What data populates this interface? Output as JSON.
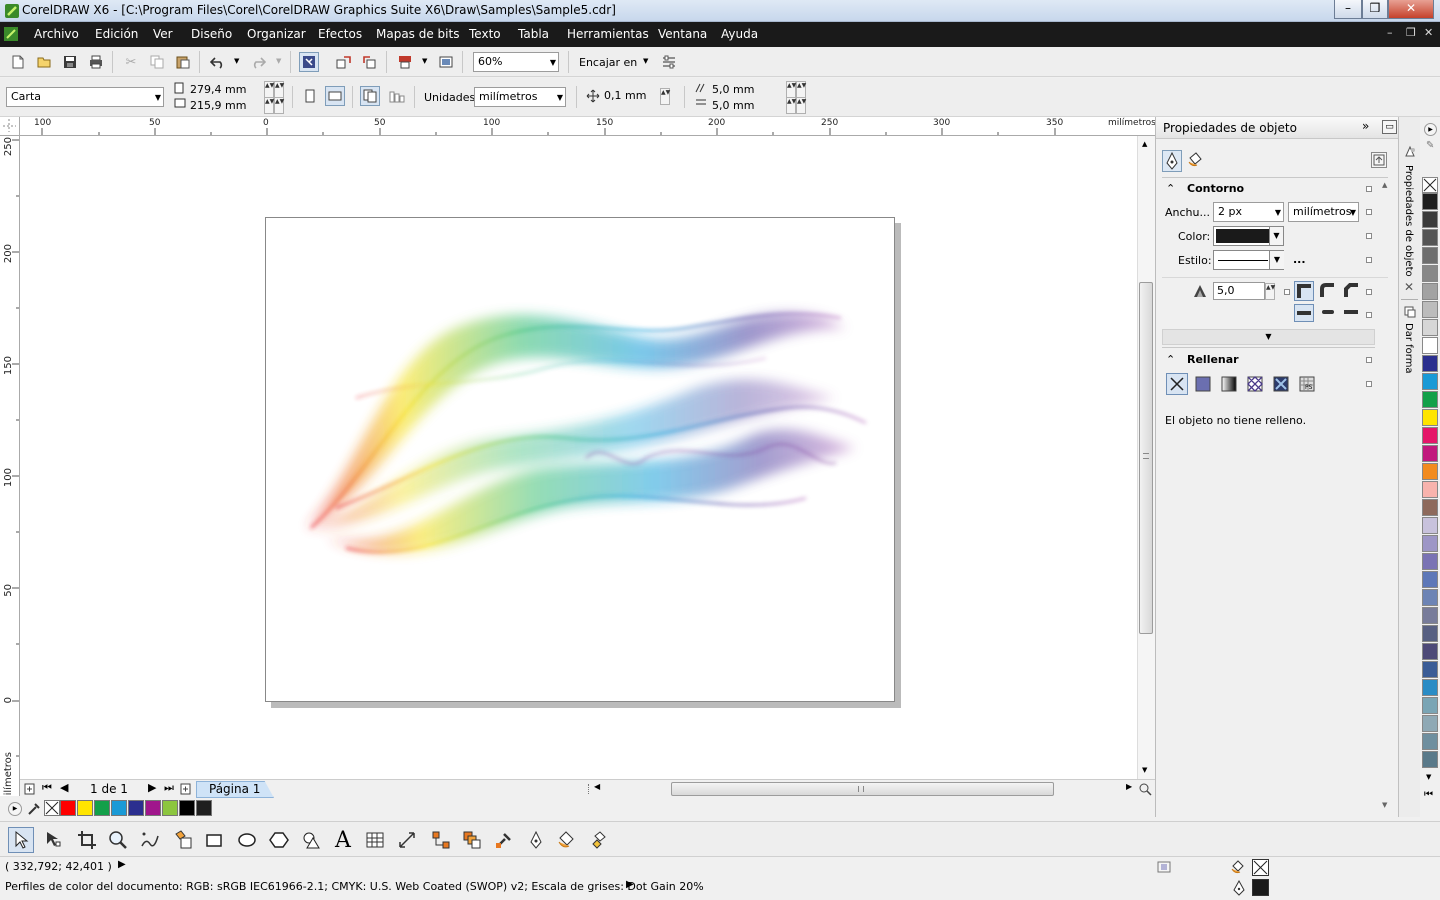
{
  "window": {
    "title": "CorelDRAW X6 - [C:\\Program Files\\Corel\\CorelDRAW Graphics Suite X6\\Draw\\Samples\\Sample5.cdr]",
    "minimize": "–",
    "restore": "❒",
    "close": "✕"
  },
  "menu": {
    "items": [
      "Archivo",
      "Edición",
      "Ver",
      "Diseño",
      "Organizar",
      "Efectos",
      "Mapas de bits",
      "Texto",
      "Tabla",
      "Herramientas",
      "Ventana",
      "Ayuda"
    ],
    "doc_min": "–",
    "doc_restore": "❒",
    "doc_close": "✕"
  },
  "standard_toolbar": {
    "zoom_value": "60%",
    "snap_label": "Encajar en"
  },
  "property_bar": {
    "page_size": "Carta",
    "width": "279,4 mm",
    "height": "215,9 mm",
    "units_label": "Unidades:",
    "units_value": "milímetros",
    "nudge": "0,1 mm",
    "dup_x": "5,0 mm",
    "dup_y": "5,0 mm"
  },
  "rulers": {
    "h_labels": [
      "100",
      "50",
      "0",
      "50",
      "100",
      "150",
      "200",
      "250",
      "300",
      "350"
    ],
    "h_unit": "milímetros",
    "v_labels": [
      "250",
      "200",
      "150",
      "100",
      "50",
      "0"
    ],
    "v_unit": "milímetros"
  },
  "page_nav": {
    "page_count": "1 de 1",
    "page_tab": "Página 1"
  },
  "docker": {
    "title": "Propiedades de objeto",
    "outline_section": "Contorno",
    "width_label": "Anchu...",
    "width_value": "2 px",
    "width_unit": "milímetros",
    "color_label": "Color:",
    "style_label": "Estilo:",
    "style_more": "...",
    "miter_value": "5,0",
    "fill_section": "Rellenar",
    "fill_message": "El objeto no tiene relleno."
  },
  "side_tabs": {
    "tab1": "Propiedades de objeto",
    "tab2": "Dar forma"
  },
  "palette_colors": [
    "#1f1f1f",
    "#3a3a3a",
    "#555555",
    "#6e6e6e",
    "#888888",
    "#a2a2a2",
    "#bcbcbc",
    "#d6d6d6",
    "#ffffff",
    "#2b2f8f",
    "#1a9ad6",
    "#13a04a",
    "#ffe500",
    "#e5176a",
    "#c1197d",
    "#f28b1f",
    "#f8b3ad",
    "#8e6a5c",
    "#c8c2dc",
    "#9d96c6",
    "#7a73b4",
    "#5e78b8",
    "#6d84b5",
    "#787c9a",
    "#586082",
    "#4e4a78",
    "#3a5c96",
    "#2a8cc5",
    "#7aa5b5",
    "#8fa9b5",
    "#6f8f9f",
    "#5a7a8a"
  ],
  "document_palette": [
    "#ff0000",
    "#ffe500",
    "#13a04a",
    "#1a9ad6",
    "#2b2f8f",
    "#a0168c",
    "#8cc63f",
    "#000000",
    "#1f1f1f"
  ],
  "status": {
    "coords": "( 332,792; 42,401 )",
    "color_profile": "Perfiles de color del documento: RGB: sRGB IEC61966-2.1; CMYK: U.S. Web Coated (SWOP) v2; Escala de grises: Dot Gain 20%"
  }
}
